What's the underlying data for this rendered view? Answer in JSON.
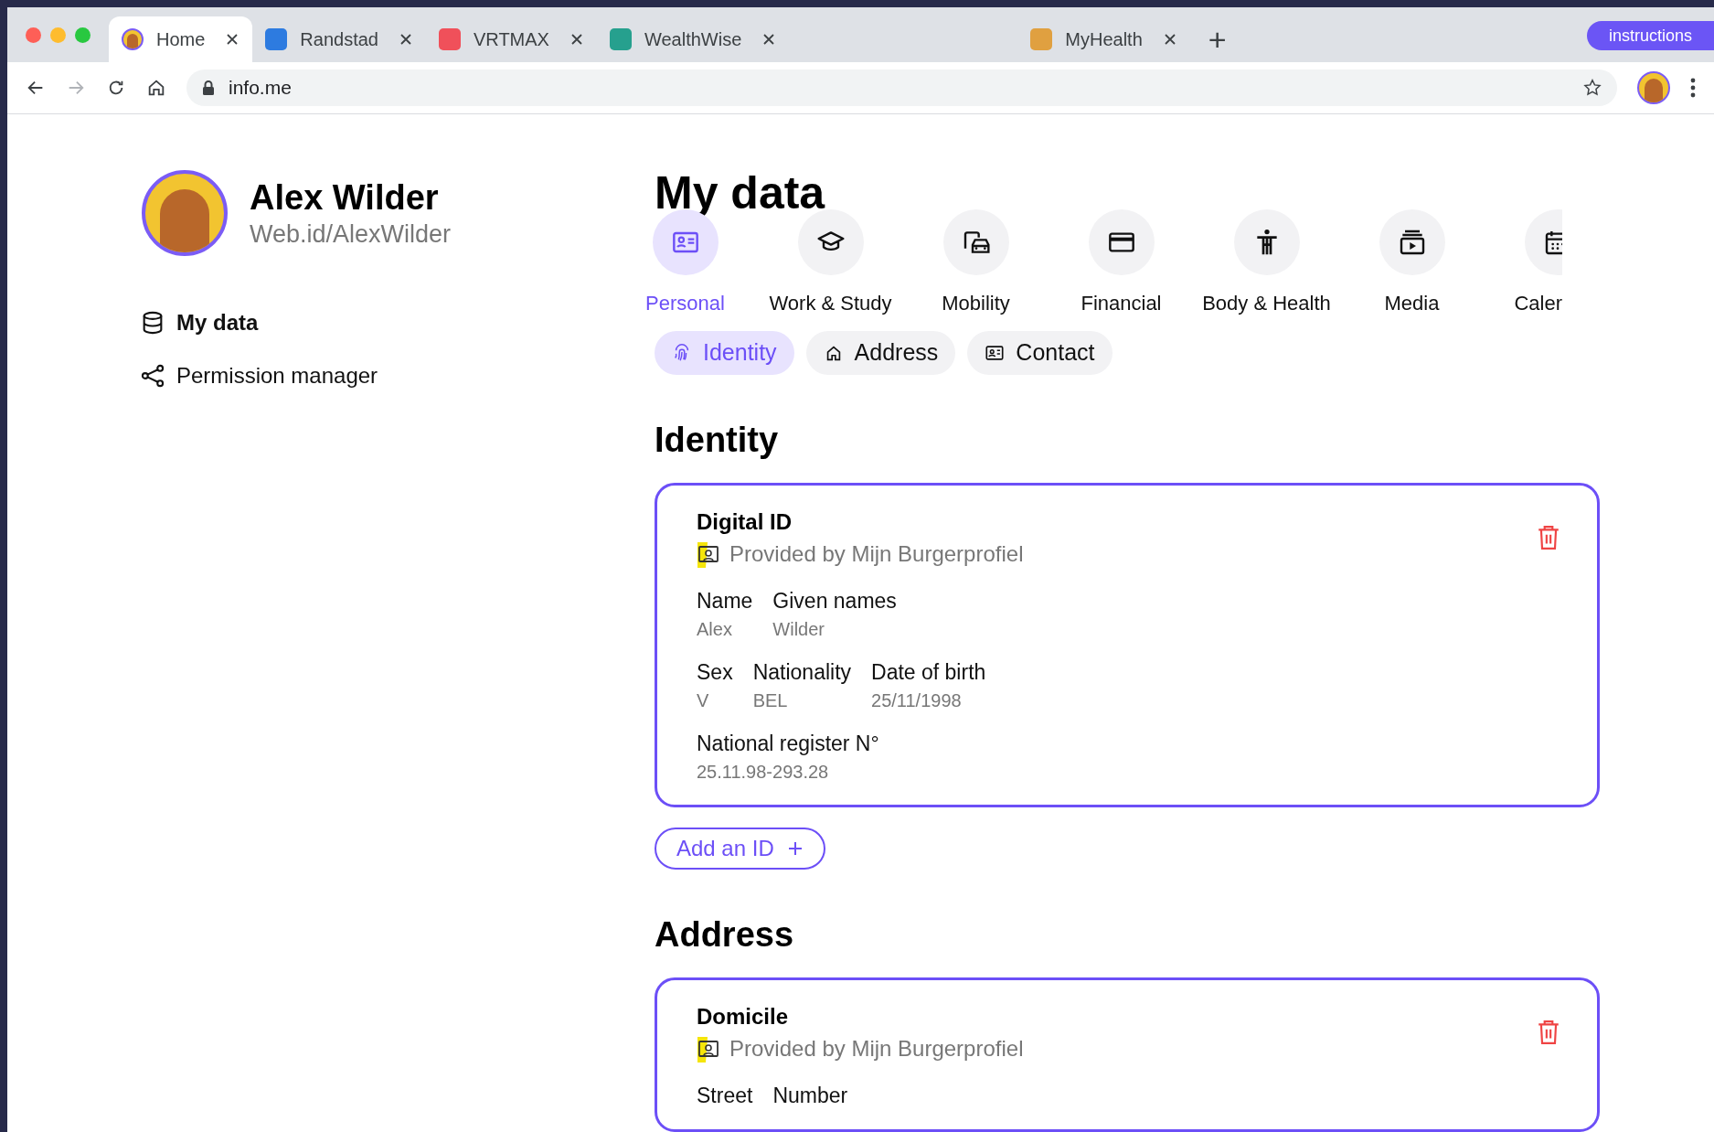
{
  "browser": {
    "tabs": [
      {
        "label": "Home",
        "selected": true
      },
      {
        "label": "Randstad",
        "selected": false,
        "color": "#2d7be0"
      },
      {
        "label": "VRTMAX",
        "selected": false,
        "color": "#f0505a"
      },
      {
        "label": "WealthWise",
        "selected": false,
        "color": "#26a08e"
      },
      {
        "label": "MyHealth",
        "selected": false,
        "color": "#e0a040"
      }
    ],
    "new_tab": "+",
    "instructions_button": "instructions",
    "url": "info.me"
  },
  "profile": {
    "name": "Alex Wilder",
    "web_id": "Web.id/AlexWilder"
  },
  "sidebar": {
    "items": [
      {
        "label": "My data",
        "selected": true
      },
      {
        "label": "Permission manager",
        "selected": false
      }
    ]
  },
  "page_title": "My data",
  "categories": [
    {
      "label": "Personal",
      "selected": true
    },
    {
      "label": "Work & Study",
      "selected": false
    },
    {
      "label": "Mobility",
      "selected": false
    },
    {
      "label": "Financial",
      "selected": false
    },
    {
      "label": "Body & Health",
      "selected": false
    },
    {
      "label": "Media",
      "selected": false
    },
    {
      "label": "Caler",
      "selected": false
    }
  ],
  "subtabs": [
    {
      "label": "Identity",
      "selected": true
    },
    {
      "label": "Address",
      "selected": false
    },
    {
      "label": "Contact",
      "selected": false
    }
  ],
  "sections": [
    {
      "heading": "Identity",
      "cards": [
        {
          "title": "Digital ID",
          "provider": "Provided by Mijn Burgerprofiel",
          "rows": [
            [
              {
                "label": "Name",
                "value": "Alex"
              },
              {
                "label": "Given names",
                "value": "Wilder"
              }
            ],
            [
              {
                "label": "Sex",
                "value": "V"
              },
              {
                "label": "Nationality",
                "value": "BEL"
              },
              {
                "label": "Date of birth",
                "value": "25/11/1998"
              }
            ],
            [
              {
                "label": "National register N°",
                "value": "25.11.98-293.28"
              }
            ]
          ]
        }
      ],
      "add_button": "Add an ID"
    },
    {
      "heading": "Address",
      "cards": [
        {
          "title": "Domicile",
          "provider": "Provided by Mijn Burgerprofiel",
          "rows": [
            [
              {
                "label": "Street"
              },
              {
                "label": "Number"
              }
            ]
          ]
        }
      ]
    }
  ]
}
